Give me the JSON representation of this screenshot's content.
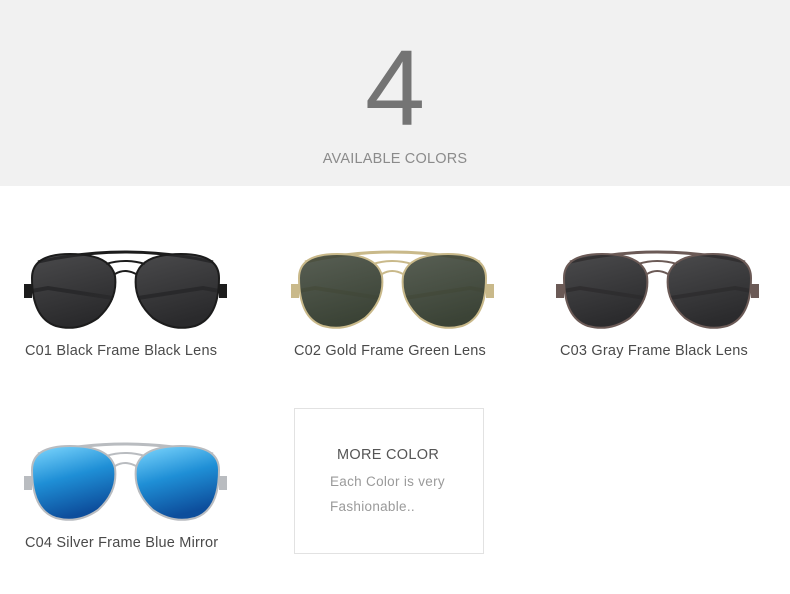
{
  "hero": {
    "number": "4",
    "subtitle": "AVAILABLE COLORS"
  },
  "products": [
    {
      "code_label": "C01 Black Frame Black Lens",
      "frame_color": "#1c1c1c",
      "lens_color": "#2a2a2c",
      "icon": "sunglasses-icon"
    },
    {
      "code_label": "C02 Gold Frame Green Lens",
      "frame_color": "#c9b98a",
      "lens_color": "#3b4336",
      "icon": "sunglasses-icon"
    },
    {
      "code_label": "C03 Gray Frame Black Lens",
      "frame_color": "#6b5a56",
      "lens_color": "#2b2b2d",
      "icon": "sunglasses-icon"
    },
    {
      "code_label": "C04 Silver Frame Blue Mirror",
      "frame_color": "#b9bcc0",
      "lens_color": "#1f8fd6",
      "icon": "sunglasses-icon"
    }
  ],
  "more_color": {
    "title": "MORE COLOR",
    "line1": "Each Color is very",
    "line2": "Fashionable.."
  }
}
